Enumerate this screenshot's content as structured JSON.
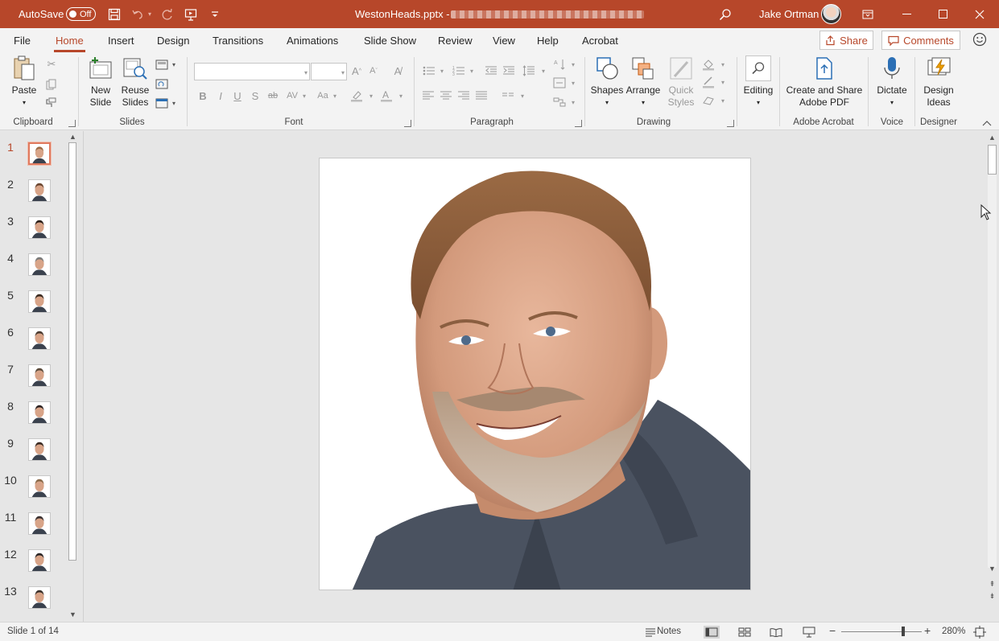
{
  "titlebar": {
    "autosave_label": "AutoSave",
    "autosave_state": "Off",
    "document_title": "WestonHeads.pptx  -",
    "user_name": "Jake Ortman",
    "accent_color": "#b7472a"
  },
  "tabs": [
    {
      "label": "File"
    },
    {
      "label": "Home",
      "active": true
    },
    {
      "label": "Insert"
    },
    {
      "label": "Design"
    },
    {
      "label": "Transitions"
    },
    {
      "label": "Animations"
    },
    {
      "label": "Slide Show"
    },
    {
      "label": "Review"
    },
    {
      "label": "View"
    },
    {
      "label": "Help"
    },
    {
      "label": "Acrobat"
    }
  ],
  "share_label": "Share",
  "comments_label": "Comments",
  "ribbon": {
    "clipboard": {
      "group": "Clipboard",
      "paste": "Paste"
    },
    "slides": {
      "group": "Slides",
      "new_slide_1": "New",
      "new_slide_2": "Slide",
      "reuse_1": "Reuse",
      "reuse_2": "Slides"
    },
    "font": {
      "group": "Font",
      "font_name": "",
      "font_size": ""
    },
    "paragraph": {
      "group": "Paragraph"
    },
    "drawing": {
      "group": "Drawing",
      "shapes": "Shapes",
      "arrange": "Arrange",
      "quick_styles_1": "Quick",
      "quick_styles_2": "Styles"
    },
    "editing": {
      "label": "Editing"
    },
    "acrobat": {
      "group": "Adobe Acrobat",
      "create_1": "Create and Share",
      "create_2": "Adobe PDF"
    },
    "voice": {
      "group": "Voice",
      "dictate": "Dictate"
    },
    "designer": {
      "group": "Designer",
      "ideas_1": "Design",
      "ideas_2": "Ideas"
    }
  },
  "thumbnails": [
    {
      "num": "1",
      "active": true
    },
    {
      "num": "2"
    },
    {
      "num": "3"
    },
    {
      "num": "4"
    },
    {
      "num": "5"
    },
    {
      "num": "6"
    },
    {
      "num": "7"
    },
    {
      "num": "8"
    },
    {
      "num": "9"
    },
    {
      "num": "10"
    },
    {
      "num": "11"
    },
    {
      "num": "12"
    },
    {
      "num": "13"
    }
  ],
  "statusbar": {
    "slide_info": "Slide 1 of 14",
    "notes_label": "Notes",
    "zoom_level": "280%"
  }
}
